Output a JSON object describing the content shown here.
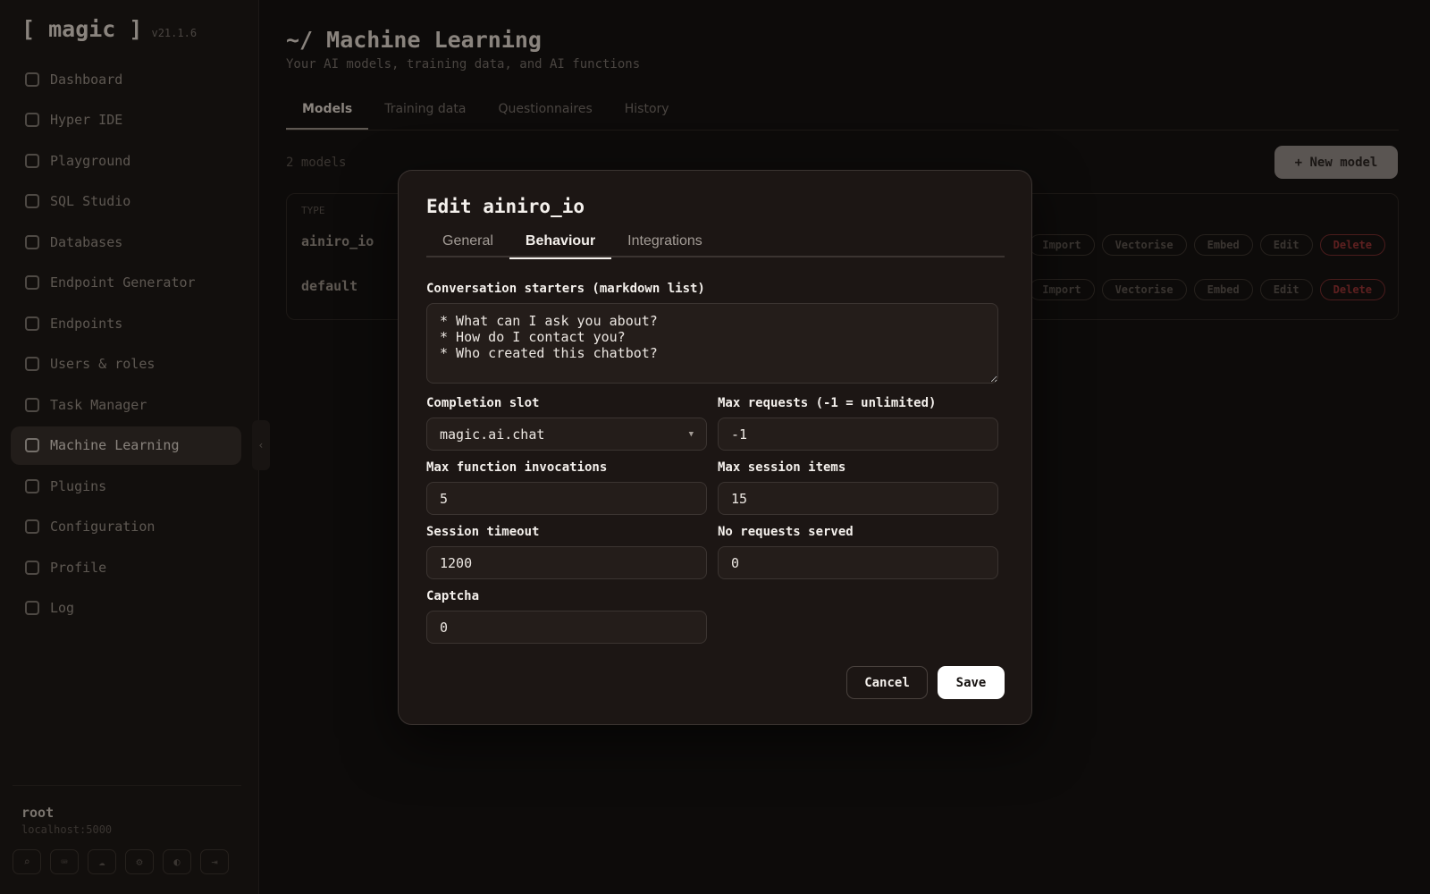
{
  "app": {
    "name": "[ magic ]",
    "version": "v21.1.6"
  },
  "sidebar": {
    "items": [
      {
        "label": "Dashboard",
        "icon": "dashboard-icon"
      },
      {
        "label": "Hyper IDE",
        "icon": "file-code-icon"
      },
      {
        "label": "Playground",
        "icon": "play-icon"
      },
      {
        "label": "SQL Studio",
        "icon": "terminal-icon"
      },
      {
        "label": "Databases",
        "icon": "database-icon"
      },
      {
        "label": "Endpoint Generator",
        "icon": "sparkle-icon"
      },
      {
        "label": "Endpoints",
        "icon": "arrows-icon"
      },
      {
        "label": "Users & roles",
        "icon": "user-icon"
      },
      {
        "label": "Task Manager",
        "icon": "clock-icon"
      },
      {
        "label": "Machine Learning",
        "icon": "sparkle-icon",
        "active": true
      },
      {
        "label": "Plugins",
        "icon": "puzzle-icon"
      },
      {
        "label": "Configuration",
        "icon": "gear-icon"
      },
      {
        "label": "Profile",
        "icon": "profile-icon"
      },
      {
        "label": "Log",
        "icon": "log-icon"
      }
    ],
    "collapse": "‹",
    "user": {
      "name": "root",
      "host": "localhost:5000"
    }
  },
  "main": {
    "title": "~/ Machine Learning",
    "subtitle": "Your AI models, training data, and AI functions",
    "tabs": [
      "Models",
      "Training data",
      "Questionnaires",
      "History"
    ],
    "count": "2 models",
    "new_model": "+ New model",
    "table": {
      "header": "TYPE",
      "rows": [
        "ainiro_io",
        "default"
      ],
      "actions": [
        "Import",
        "Vectorise",
        "Embed",
        "Edit",
        "Delete"
      ]
    }
  },
  "modal": {
    "title": "Edit ainiro_io",
    "tabs": [
      "General",
      "Behaviour",
      "Integrations"
    ],
    "active_tab": "Behaviour",
    "fields": {
      "conversation_starters": {
        "label": "Conversation starters (markdown list)",
        "value": "* What can I ask you about?\n* How do I contact you?\n* Who created this chatbot?"
      },
      "completion_slot": {
        "label": "Completion slot",
        "value": "magic.ai.chat"
      },
      "max_requests": {
        "label": "Max requests (-1 = unlimited)",
        "value": "-1"
      },
      "max_function_invocations": {
        "label": "Max function invocations",
        "value": "5"
      },
      "max_session_items": {
        "label": "Max session items",
        "value": "15"
      },
      "session_timeout": {
        "label": "Session timeout",
        "value": "1200"
      },
      "no_requests_served": {
        "label": "No requests served",
        "value": "0"
      },
      "captcha": {
        "label": "Captcha",
        "value": "0"
      }
    },
    "cancel": "Cancel",
    "save": "Save"
  },
  "colors": {
    "background": "#0d0b0a",
    "modal_bg": "#1c1614",
    "input_bg": "#241d1a",
    "border": "#3b3431",
    "danger": "#5e2020",
    "save_bg": "#ffffff"
  }
}
